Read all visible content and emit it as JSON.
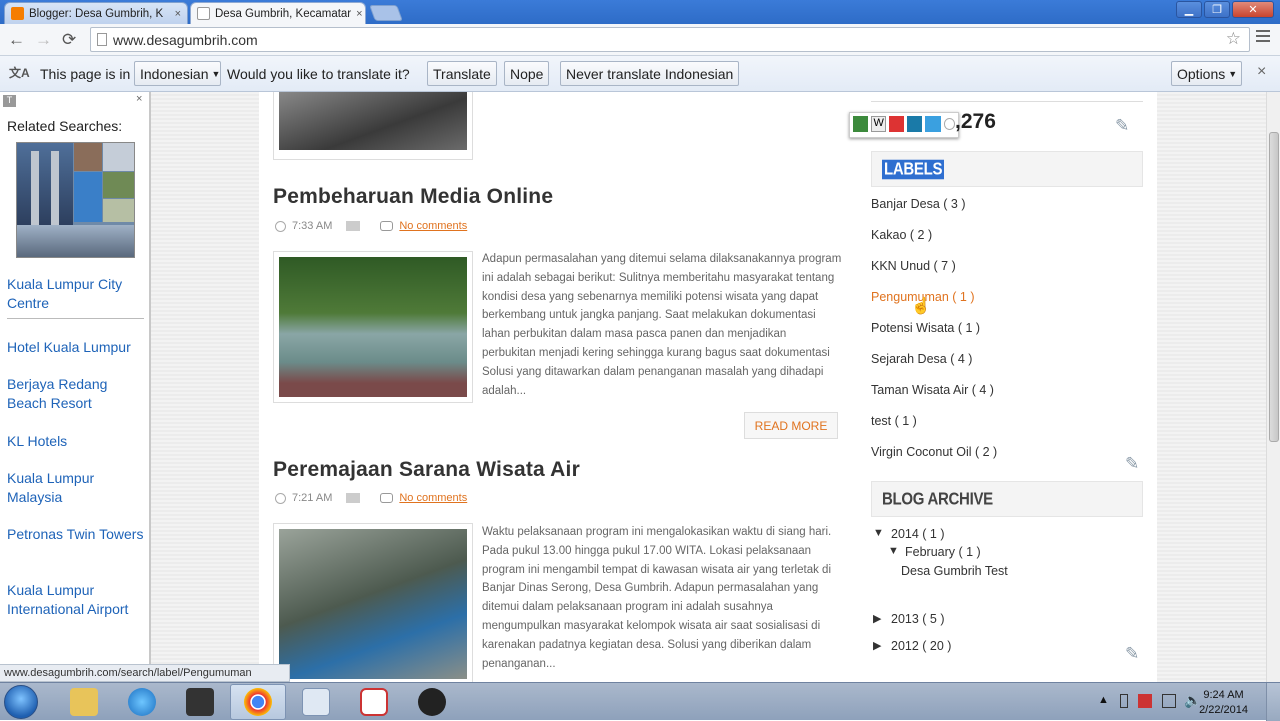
{
  "tabs": [
    {
      "title": "Blogger: Desa Gumbrih, K",
      "close": "×",
      "active": false
    },
    {
      "title": "Desa Gumbrih, Kecamatar",
      "close": "×",
      "active": true
    }
  ],
  "window": {
    "minimize": "▁",
    "maximize": "❐",
    "close": "✕"
  },
  "nav": {
    "back": "←",
    "forward": "→",
    "reload": "⟳",
    "url": "www.desagumbrih.com",
    "star": "☆"
  },
  "translate": {
    "prefix": "This page is in",
    "language": "Indonesian",
    "question": "Would you like to translate it?",
    "translate_btn": "Translate",
    "nope_btn": "Nope",
    "never_btn": "Never translate Indonesian",
    "options_btn": "Options",
    "close": "×"
  },
  "left_panel": {
    "t_icon": "T",
    "close": "×",
    "heading": "Related Searches:",
    "links": [
      "Kuala Lumpur City Centre",
      "Hotel Kuala Lumpur",
      "Berjaya Redang Beach Resort",
      "KL Hotels",
      "Kuala Lumpur Malaysia",
      "Petronas Twin Towers",
      "Kuala Lumpur International Airport"
    ]
  },
  "status_url": "www.desagumbrih.com/search/label/Pengumuman",
  "posts": [
    {
      "title": "Pembeharuan Media Online",
      "time": "7:33 AM",
      "comments": "No comments",
      "excerpt": "Adapun permasalahan yang ditemui selama dilaksanakannya program ini adalah sebagai berikut: Sulitnya memberitahu masyarakat tentang kondisi desa yang sebenarnya memiliki potensi wisata yang dapat berkembang untuk jangka panjang.  Saat melakukan dokumentasi lahan perbukitan dalam masa pasca panen dan menjadikan perbukitan menjadi kering sehingga kurang bagus saat dokumentasi Solusi yang ditawarkan dalam penanganan masalah yang dihadapi adalah...",
      "read_more": "READ MORE"
    },
    {
      "title": "Peremajaan Sarana Wisata Air",
      "time": "7:21 AM",
      "comments": "No comments",
      "excerpt": "Waktu pelaksanaan program ini mengalokasikan waktu di siang hari. Pada pukul 13.00 hingga pukul 17.00 WITA. Lokasi pelaksanaan program ini mengambil tempat di kawasan wisata air yang terletak di Banjar Dinas Serong, Desa Gumbrih. Adapun permasalahan yang ditemui dalam pelaksanaan program ini adalah susahnya mengumpulkan masyarakat kelompok wisata air saat sosialisasi di karenakan padatnya kegiatan desa. Solusi yang diberikan dalam penanganan..."
    }
  ],
  "sidebar": {
    "counter": ",276",
    "labels_title": "LABELS",
    "labels": [
      "Banjar Desa ( 3 )",
      "Kakao ( 2 )",
      "KKN Unud ( 7 )",
      "Pengumuman ( 1 )",
      "Potensi Wisata ( 1 )",
      "Sejarah Desa ( 4 )",
      "Taman Wisata Air ( 4 )",
      "test ( 1 )",
      "Virgin Coconut Oil ( 2 )"
    ],
    "archive_title": "BLOG ARCHIVE",
    "archive": {
      "y2014": "2014 ( 1 )",
      "feb": "February ( 1 )",
      "post": "Desa Gumbrih Test",
      "y2013": "2013 ( 5 )",
      "y2012": "2012 ( 20 )"
    }
  },
  "taskbar": {
    "time": "9:24 AM",
    "date": "2/22/2014"
  }
}
